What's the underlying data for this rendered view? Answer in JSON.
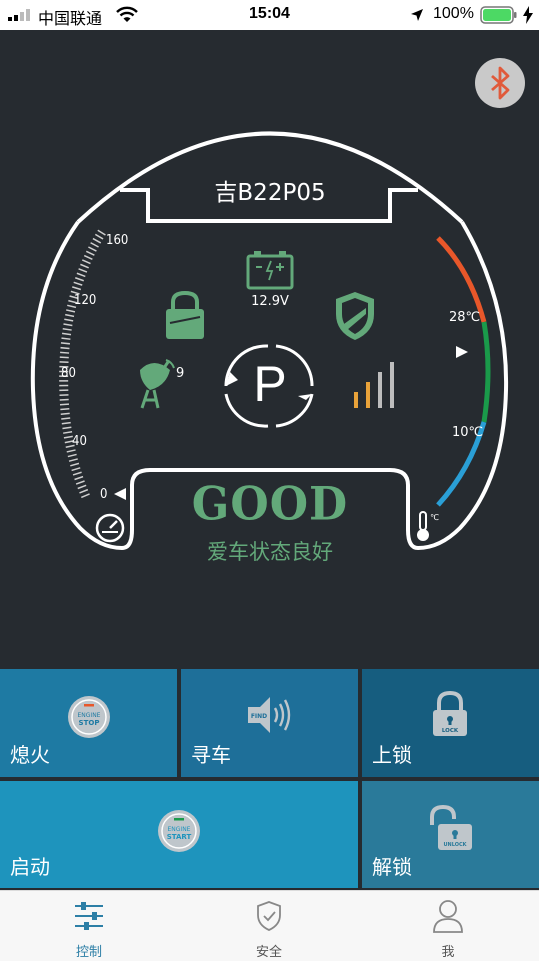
{
  "status_bar": {
    "carrier": "中国联通",
    "time": "15:04",
    "battery": "100%"
  },
  "dashboard": {
    "plate": "吉B22P05",
    "voltage": "12.9V",
    "satellite_count": "9",
    "gear": "P",
    "speed_ticks": [
      "160",
      "120",
      "80",
      "40",
      "0"
    ],
    "temp_ticks": [
      "28℃",
      "10℃"
    ],
    "status_title": "GOOD",
    "status_subtitle": "爱车状态良好",
    "icons": [
      "bluetooth-icon",
      "battery-icon",
      "lock-icon",
      "shield-icon",
      "satellite-icon",
      "signal-icon",
      "speedometer-icon",
      "thermometer-icon"
    ],
    "colors": {
      "accent_green": "#63a97a",
      "hot": "#e8572a",
      "mid": "#1a9a4a",
      "cold": "#2a9fd6",
      "background": "#262b30"
    }
  },
  "controls": {
    "engine_stop": {
      "label": "熄火",
      "badge_top": "ENGINE",
      "badge_bottom": "STOP"
    },
    "find_car": {
      "label": "寻车",
      "badge": "FIND"
    },
    "lock": {
      "label": "上锁",
      "badge": "LOCK"
    },
    "engine_start": {
      "label": "启动",
      "badge_top": "ENGINE",
      "badge_bottom": "START"
    },
    "unlock": {
      "label": "解锁",
      "badge": "UNLOCK"
    }
  },
  "tabs": [
    {
      "label": "控制",
      "icon": "sliders-icon",
      "active": true
    },
    {
      "label": "安全",
      "icon": "shield-check-icon",
      "active": false
    },
    {
      "label": "我",
      "icon": "user-icon",
      "active": false
    }
  ]
}
